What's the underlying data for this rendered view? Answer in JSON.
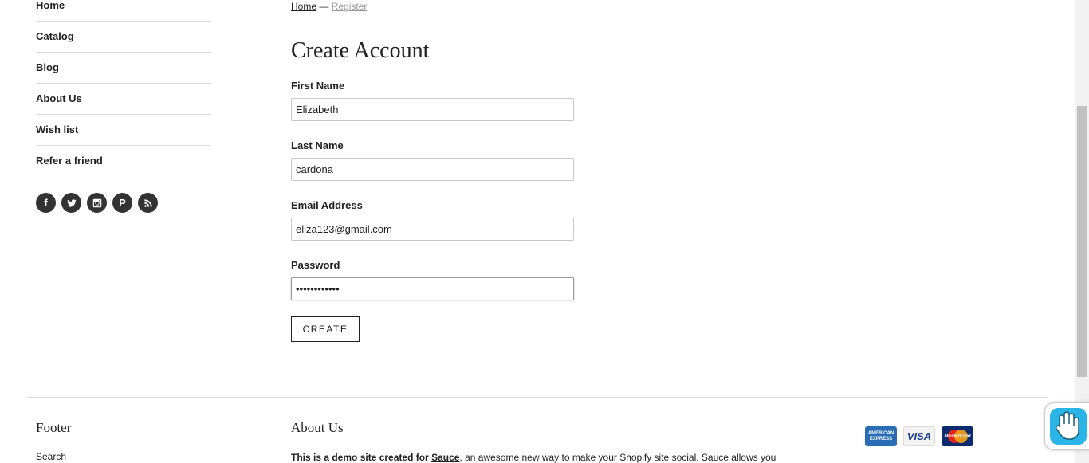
{
  "sidebar": {
    "items": [
      {
        "label": "Home"
      },
      {
        "label": "Catalog"
      },
      {
        "label": "Blog"
      },
      {
        "label": "About Us"
      },
      {
        "label": "Wish list"
      },
      {
        "label": "Refer a friend"
      }
    ],
    "social": [
      {
        "icon": "facebook-icon",
        "glyph": "f"
      },
      {
        "icon": "twitter-icon"
      },
      {
        "icon": "instagram-icon"
      },
      {
        "icon": "pinterest-icon",
        "glyph": "P"
      },
      {
        "icon": "rss-icon"
      }
    ]
  },
  "breadcrumb": {
    "home": "Home",
    "separator": "—",
    "current": "Register"
  },
  "form": {
    "title": "Create Account",
    "first_name": {
      "label": "First Name",
      "value": "Elizabeth"
    },
    "last_name": {
      "label": "Last Name",
      "value": "cardona"
    },
    "email": {
      "label": "Email Address",
      "value": "eliza123@gmail.com"
    },
    "password": {
      "label": "Password",
      "value": "••••••••••••"
    },
    "submit_label": "CREATE"
  },
  "footer": {
    "footer_heading": "Footer",
    "search_link": "Search",
    "about_heading": "About Us",
    "about_text_prefix": "This is a demo site created for",
    "about_link": "Sauce",
    "about_text_suffix": ", an awesome new way to make your Shopify site social. Sauce allows you",
    "payments": [
      {
        "name": "amex-icon",
        "label": "AMERICAN EXPRESS"
      },
      {
        "name": "visa-icon",
        "label": "VISA"
      },
      {
        "name": "mastercard-icon",
        "label": "MasterCard"
      }
    ]
  },
  "colors": {
    "text": "#222222",
    "divider": "#dcdcdc",
    "social_bg": "#333333",
    "widget_accent": "#2bb4e6"
  }
}
